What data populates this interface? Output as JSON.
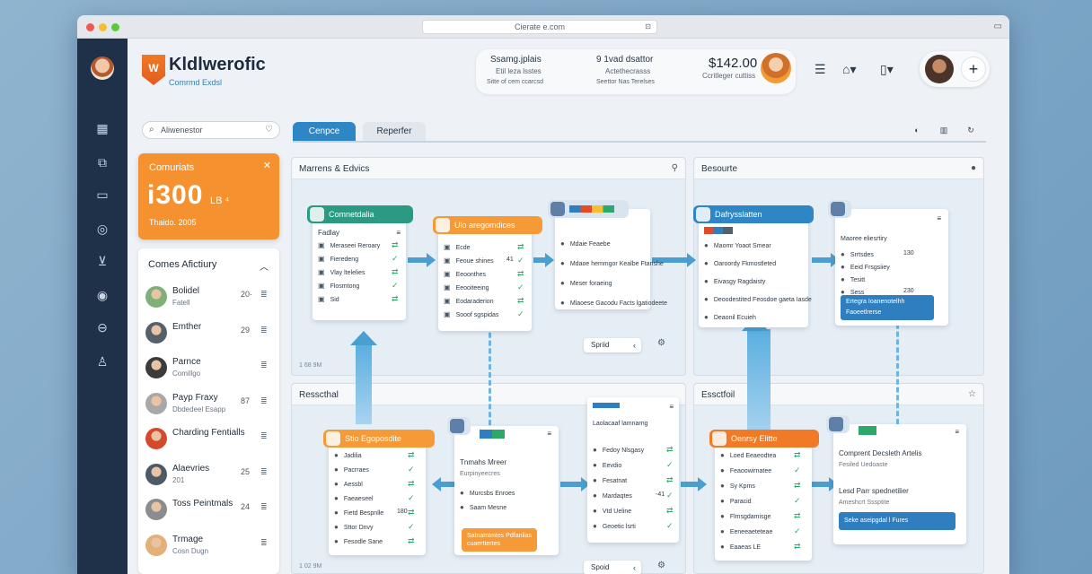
{
  "browser": {
    "url": "Cierate e.com"
  },
  "rail": {
    "icons": [
      "app-avatar",
      "grid-icon",
      "layers-icon",
      "card-icon",
      "badge-icon",
      "tag-icon",
      "target-icon",
      "cloud-icon",
      "user-icon"
    ]
  },
  "brand": {
    "name": "Kldlwerofic",
    "subtitle": "Comrmd Exdsl",
    "logo_letter": "W"
  },
  "header": {
    "stat1_title": "Ssamg.jplais",
    "stat1_sub": "Etil leza lsstes",
    "stat1_note": "Sitte of cem ccarcsd",
    "stat2_title": "9 1vad dsattor",
    "stat2_sub": "Actethecrasss",
    "stat2_note": "Seettor Nas Terelses",
    "price": "$142.00",
    "price_sub": "Ccritleger cuttiss",
    "plus": "+"
  },
  "search": {
    "placeholder": "Aliwenestor"
  },
  "tabs": [
    {
      "label": "Cenpce",
      "active": true
    },
    {
      "label": "Reperfer",
      "active": false
    }
  ],
  "orange_card": {
    "title": "Comuriats",
    "value": "i300",
    "unit": "LB ⁴",
    "sub": "Thaido. 2005"
  },
  "activity": {
    "title": "Comes Afictiury",
    "items": [
      {
        "name": "Bolidel",
        "sub": "Fatell",
        "count": "20·"
      },
      {
        "name": "Emther",
        "sub": "",
        "count": "29"
      },
      {
        "name": "Parnce",
        "sub": "Comillgo",
        "count": ""
      },
      {
        "name": "Payp Fraxy",
        "sub": "Dbdedeel Esapp",
        "count": "87"
      },
      {
        "name": "Charding Fentialls",
        "sub": "",
        "count": ""
      },
      {
        "name": "Alaevries",
        "sub": "201",
        "count": "25"
      },
      {
        "name": "Toss Peintmals",
        "sub": "",
        "count": "24"
      },
      {
        "name": "Trmage",
        "sub": "Cosn Dugn",
        "count": ""
      }
    ],
    "colors": [
      "#7fb07a",
      "#55606b",
      "#3b3b3b",
      "#a8a8a8",
      "#d4492c",
      "#4b5a66",
      "#8a8c8f",
      "#e3b077"
    ]
  },
  "panels": {
    "p1": {
      "title": "Marrens & Edvics",
      "foot": "1 68 9M"
    },
    "p2": {
      "title": "Besourte"
    },
    "p3": {
      "title": "Resscthal",
      "foot": "1 02 9M"
    },
    "p4": {
      "title": "Essctfoil"
    }
  },
  "nodes": {
    "n1": {
      "head": "Comnetdalia",
      "sub": "Fadlay",
      "rows": [
        "Meraseei Reroary",
        "Fieredeng",
        "Vlay ltelelies",
        "Flosmtong",
        "Sid"
      ],
      "vals": [
        "",
        "",
        "",
        "",
        ""
      ]
    },
    "n2": {
      "head": "Ulo aregomdices",
      "rows": [
        "Ecde",
        "Feoue shines",
        "Eeoonthes",
        "Eeooiteeing",
        "Eodaraderion",
        "Sooof sgspidas"
      ],
      "vals": [
        "",
        "41",
        "",
        "",
        "",
        ""
      ]
    },
    "n3": {
      "rows": [
        "Mdaie Feaebe",
        "Mdaoe hemmgor Kealbe Ftanshe",
        "Meser foraeing",
        "Mlaoese Gacodu Facts lgatiodeete"
      ]
    },
    "n4": {
      "head": "Dafrysslatten",
      "rows": [
        "Maomr Yoaot Smear",
        "Oaroordy Fkmostleted",
        "Eivasgy Ragdaisty",
        "Deoodestited Feosdoe gaeta Iasde",
        "Deaonil Ecuieh"
      ]
    },
    "n5": {
      "title": "Maoree eliesrtiry",
      "rows": [
        "Srrtsdes",
        "Eeid Frsgsiiey",
        "Tesitt",
        "Sess"
      ],
      "vals": [
        "130",
        "",
        "",
        "230"
      ],
      "btn": "Ertegra Ioanenotelhh Faoeetlrerse"
    },
    "n6": {
      "head": "Stio Egoposdite",
      "rows": [
        "Jadilia",
        "Pacrraes",
        "Aessbl",
        "Faeaeseel",
        "Fietd Bespnlle",
        "Sttor Dnvy",
        "Fesodle Sane"
      ],
      "vals": [
        "",
        "",
        "",
        "",
        "180",
        "",
        ""
      ]
    },
    "n7": {
      "title": "Tnmahs Mreer",
      "sub": "Eurpinyeecres",
      "rows": [
        "Murcsbs Enroes",
        "Saam Mesne"
      ],
      "btn": "Satnamtmtes Pdfanlias cuaerttertes"
    },
    "n8": {
      "title": "Laolacaaf lamnarng",
      "rows": [
        "Fedoy Nlsgasy",
        "Eevdio",
        "Fesatnat",
        "Mardaqtes",
        "Vtd Ueline",
        "Geoetic lsrti"
      ],
      "vals": [
        "",
        "",
        "",
        "-41",
        "",
        ""
      ]
    },
    "n9": {
      "head": "Oenrsy Elitte",
      "rows": [
        "Loed Eeaeodtea",
        "Feaoowirnatee",
        "Sy Kpms",
        "Paracid",
        "Flmsgdamisge",
        "Eeneeaeteteae",
        "Eaaeas LE"
      ]
    },
    "n10": {
      "title": "Comprent Decsleth Artelis",
      "sub": "Fesiled Uedoaste",
      "title2": "Lesd Parr spednetilier",
      "sub2": "Ameshcrt Sssptite",
      "btn": "Seke aseipgdal l Fures"
    }
  },
  "chips": {
    "c1": "Spriid",
    "c2": "Spoid"
  },
  "accent": {
    "orange": "#f5922f",
    "blue": "#2f80b8",
    "navy": "#1f3148",
    "green": "#2da86b"
  }
}
